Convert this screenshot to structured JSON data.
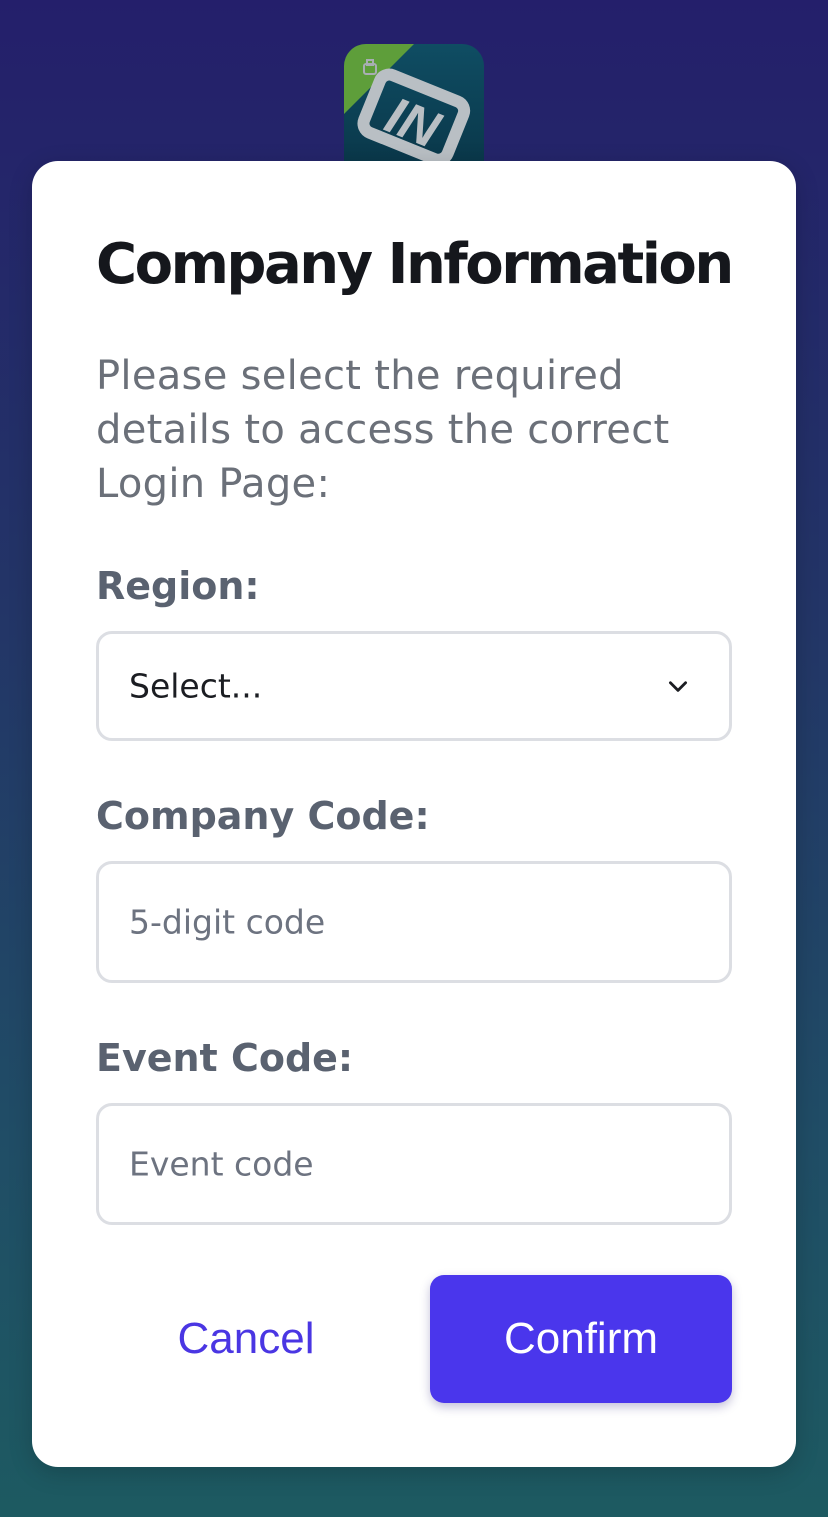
{
  "logo": {
    "icon": "in-logo-icon",
    "text": "IN",
    "colors": {
      "background": "#0f4d63",
      "accent": "#5e9e3a",
      "letters": "#b9bfc4"
    }
  },
  "modal": {
    "title": "Company Information",
    "description": "Please select the required details to access the correct Login Page:"
  },
  "fields": {
    "region": {
      "label": "Region:",
      "selected": "Select...",
      "icon": "chevron-down-icon"
    },
    "company_code": {
      "label": "Company Code:",
      "placeholder": "5-digit code",
      "value": ""
    },
    "event_code": {
      "label": "Event Code:",
      "placeholder": "Event code",
      "value": ""
    }
  },
  "actions": {
    "cancel_label": "Cancel",
    "confirm_label": "Confirm"
  },
  "colors": {
    "accent": "#4a36ec",
    "title_text": "#15171c",
    "secondary_text": "#6b7079",
    "input_border": "#dcdee3"
  }
}
